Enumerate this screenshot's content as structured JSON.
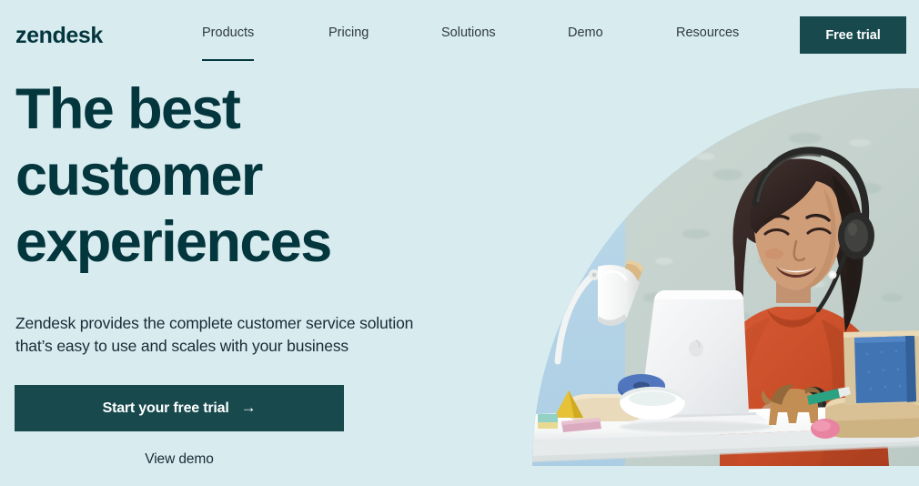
{
  "brand": {
    "logo_text": "zendesk",
    "accent_dark": "#17494d",
    "heading_color": "#03363d",
    "page_background": "#d8ecf0"
  },
  "nav": {
    "items": [
      {
        "label": "Products",
        "active": true
      },
      {
        "label": "Pricing",
        "active": false
      },
      {
        "label": "Solutions",
        "active": false
      },
      {
        "label": "Demo",
        "active": false
      },
      {
        "label": "Resources",
        "active": false
      }
    ],
    "cta_label": "Free trial"
  },
  "hero": {
    "headline_line1": "The best",
    "headline_line2": "customer",
    "headline_line3": "experiences",
    "subhead_line1": "Zendesk provides the complete customer service solution",
    "subhead_line2": "that’s easy to use and scales with your business",
    "primary_cta_label": "Start your free trial",
    "primary_cta_icon": "arrow-right-icon",
    "secondary_cta_label": "View demo",
    "image_alt": "Smiling woman wearing a headset working on a laptop at a white desk"
  }
}
